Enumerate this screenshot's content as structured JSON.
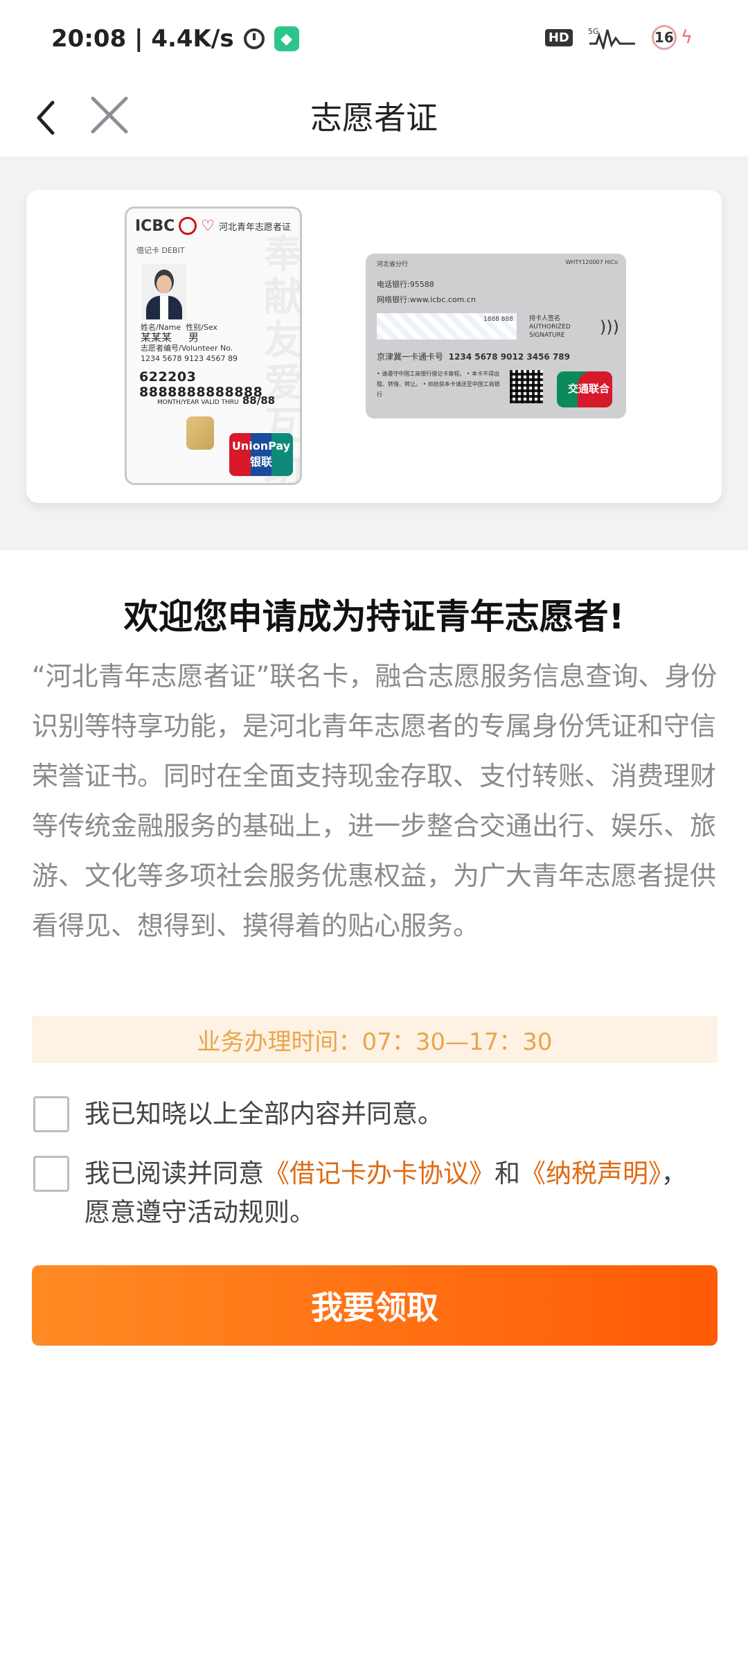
{
  "status_bar": {
    "time_speed": "20:08 | 4.4K/s",
    "hd": "HD",
    "network": "5G",
    "battery": "16"
  },
  "nav": {
    "title": "志愿者证"
  },
  "card_front": {
    "bank": "ICBC",
    "title": "河北青年志愿者证",
    "card_type": "借记卡 DEBIT",
    "bg_text": "奉献友爱互助进步",
    "name_label": "姓名/Name",
    "name": "某某某",
    "sex_label": "性别/Sex",
    "sex": "男",
    "volunteer_label": "志愿者编号/Volunteer No.",
    "volunteer_no": "1234 5678 9123 4567 89",
    "card_number": "622203 8888888888888",
    "valid_label": "MONTH/YEAR VALID THRU",
    "valid": "88/88",
    "unionpay": "UnionPay 银联"
  },
  "card_back": {
    "branch": "河北省分行",
    "code": "WHTY120007 HiCo",
    "phone_bank": "电话银行:95588",
    "web_bank": "网络银行:www.icbc.com.cn",
    "strip_no": "1888 888",
    "signature": "持卡人签名 AUTHORIZED SIGNATURE",
    "transit_label": "京津冀一卡通卡号",
    "transit_no": "1234 5678 9012 3456 789",
    "notes": "• 请遵守中国工商银行借记卡章程。 • 本卡不得出租、转借、转让。 • 如拾获本卡请送至中国工商银行",
    "transit_logo": "交通联合"
  },
  "headline": "欢迎您申请成为持证青年志愿者!",
  "intro": "“河北青年志愿者证”联名卡，融合志愿服务信息查询、身份识别等特享功能，是河北青年志愿者的专属身份凭证和守信荣誉证书。同时在全面支持现金存取、支付转账、消费理财等传统金融服务的基础上，进一步整合交通出行、娱乐、旅游、文化等多项社会服务优惠权益，为广大青年志愿者提供看得见、想得到、摸得着的贴心服务。",
  "hours": "业务办理时间：07：30—17：30",
  "agree1": "我已知晓以上全部内容并同意。",
  "agree2": {
    "prefix": "我已阅读并同意",
    "link1": "《借记卡办卡协议》",
    "mid": "和",
    "link2": "《纳税声明》",
    "suffix": "，愿意遵守活动规则。"
  },
  "button": "我要领取",
  "colors": {
    "accent": "#ff6a10",
    "link": "#e06a12",
    "hours_text": "#e9a54a",
    "hours_bg": "#fdf2e3"
  }
}
